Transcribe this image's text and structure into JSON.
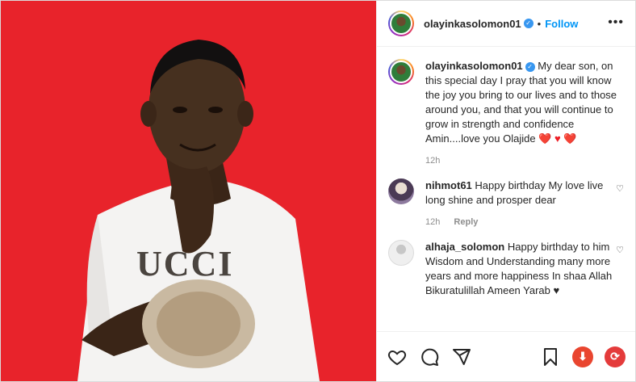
{
  "post": {
    "username": "olayinkasolomon01",
    "follow_label": "Follow",
    "separator": "•",
    "more": "•••"
  },
  "caption": {
    "username": "olayinkasolomon01",
    "text": "My dear son, on this special day I pray that you will know the joy you bring to our lives and to those around you, and that you will continue to grow in strength and confidence Amin....love you Olajide",
    "emoji": "❤️ ♥ ❤️",
    "time": "12h"
  },
  "comments": [
    {
      "username": "nihmot61",
      "text": "Happy birthday My love live long shine and prosper dear",
      "time": "12h",
      "reply": "Reply"
    },
    {
      "username": "alhaja_solomon",
      "text": "Happy birthday to him Wisdom and Understanding many more years and more happiness In shaa Allah Bikuratulillah Ameen Yarab",
      "emoji": "♥"
    }
  ],
  "photo": {
    "background": "#e8232b",
    "shirt_text": "UCCI"
  },
  "colors": {
    "accent": "#0095f6",
    "download": "#e9452f",
    "refresh": "#e43b3b"
  },
  "icons": [
    "heart-icon",
    "comment-icon",
    "share-icon",
    "bookmark-icon",
    "download-icon",
    "refresh-icon"
  ]
}
